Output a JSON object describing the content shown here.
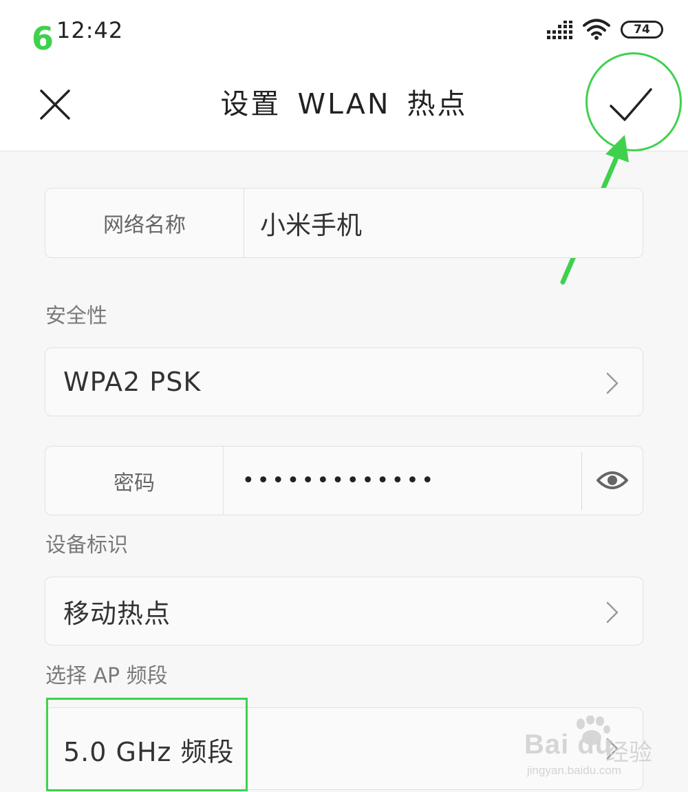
{
  "status_bar": {
    "step_number": "6",
    "time": "12:42",
    "battery_level": "74"
  },
  "header": {
    "title": "设置 WLAN 热点"
  },
  "form": {
    "network_name_label": "网络名称",
    "network_name_value": "小米手机",
    "security_section": "安全性",
    "security_value": "WPA2 PSK",
    "password_label": "密码",
    "password_masked": "•••••••••••••",
    "device_id_section": "设备标识",
    "device_id_value": "移动热点",
    "ap_band_section": "选择 AP 频段",
    "ap_band_value": "5.0 GHz 频段"
  },
  "watermark": {
    "logo_text": "Bai du",
    "cn_text": "经验",
    "url": "jingyan.baidu.com"
  },
  "colors": {
    "annotation_green": "#3fd14d",
    "background": "#f7f7f7",
    "card_background": "#fafafa"
  },
  "icons": [
    "close-icon",
    "checkmark-icon",
    "chevron-right-icon",
    "eye-icon",
    "signal-icon",
    "wifi-icon",
    "battery-icon"
  ]
}
